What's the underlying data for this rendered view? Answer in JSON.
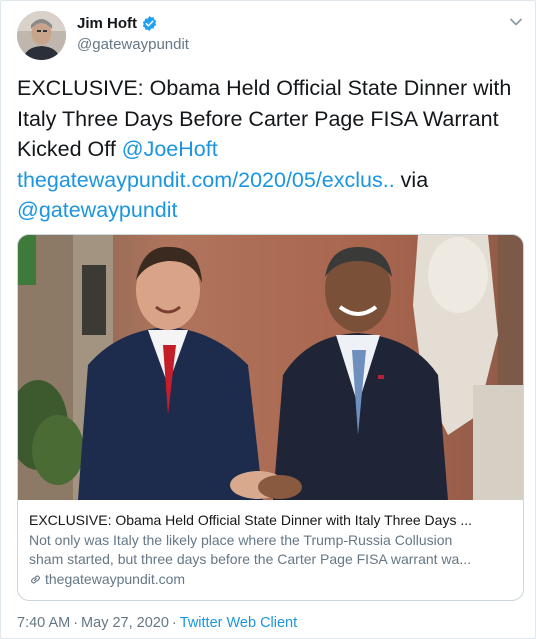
{
  "author": {
    "display_name": "Jim Hoft",
    "handle": "@gatewaypundit",
    "verified": true,
    "avatar_icon": "avatar-photo"
  },
  "tweet": {
    "text_line1": "EXCLUSIVE: Obama Held Official State Dinner with",
    "text_line2": "Italy Three Days Before Carter Page FISA Warrant",
    "text_line3": "Kicked Off ",
    "mention": "@JoeHoft",
    "url": "thegatewaypundit.com/2020/05/exclus..",
    "via": " via",
    "via_mention": "@gatewaypundit"
  },
  "card": {
    "image_icon": "photo-two-men-handshake",
    "title": "EXCLUSIVE: Obama Held Official State Dinner with Italy Three Days ...",
    "desc_line1": "Not only was Italy the likely place where the Trump-Russia Collusion",
    "desc_line2": "sham started, but three days before the Carter Page FISA warrant wa...",
    "domain": "thegatewaypundit.com",
    "domain_icon": "link-icon"
  },
  "meta": {
    "time": "7:40 AM",
    "separator": "·",
    "date": "May 27, 2020",
    "client": "Twitter Web Client"
  },
  "colors": {
    "link": "#1b95e0",
    "verified": "#1da1f2",
    "secondary_text": "#657786"
  }
}
